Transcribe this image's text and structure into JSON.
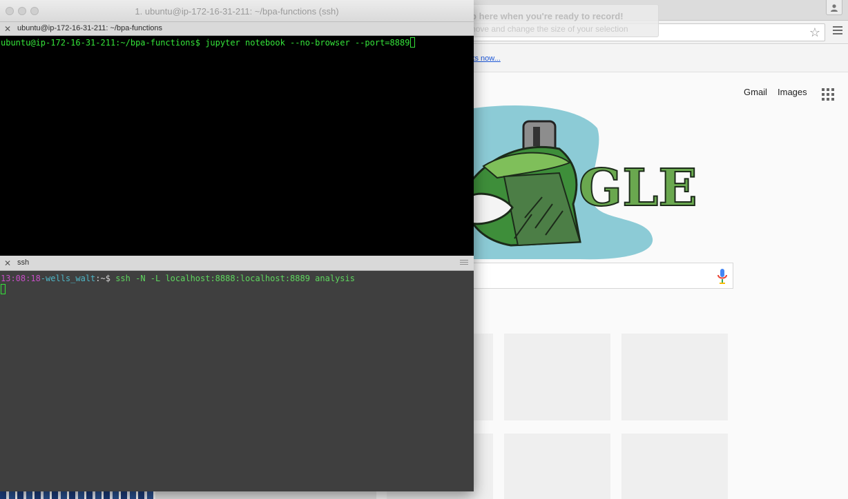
{
  "browser": {
    "record_overlay": {
      "title": "Click up here when you're ready to record!",
      "subtitle": "You can move and change the size of your selection"
    },
    "bookmark_link": "ks now...",
    "google": {
      "gmail_label": "Gmail",
      "images_label": "Images",
      "doodle_text": "GLE"
    }
  },
  "iterm": {
    "window_title": "1. ubuntu@ip-172-16-31-211: ~/bpa-functions (ssh)",
    "top_pane": {
      "tab_label": "ubuntu@ip-172-16-31-211: ~/bpa-functions",
      "prompt": "ubuntu@ip-172-16-31-211:~/bpa-functions$",
      "command": " jupyter notebook --no-browser --port=8889"
    },
    "bottom_pane": {
      "tab_label": "ssh",
      "time": "13:08:18",
      "user": "-wells_walt",
      "path": ":~",
      "dollar": "$",
      "command": " ssh -N -L localhost:8888:localhost:8889 analysis"
    }
  },
  "colors": {
    "top_prompt": "#35e43a",
    "time": "#c64fc6",
    "user": "#4fb6c6",
    "command": "#5fd75f"
  }
}
